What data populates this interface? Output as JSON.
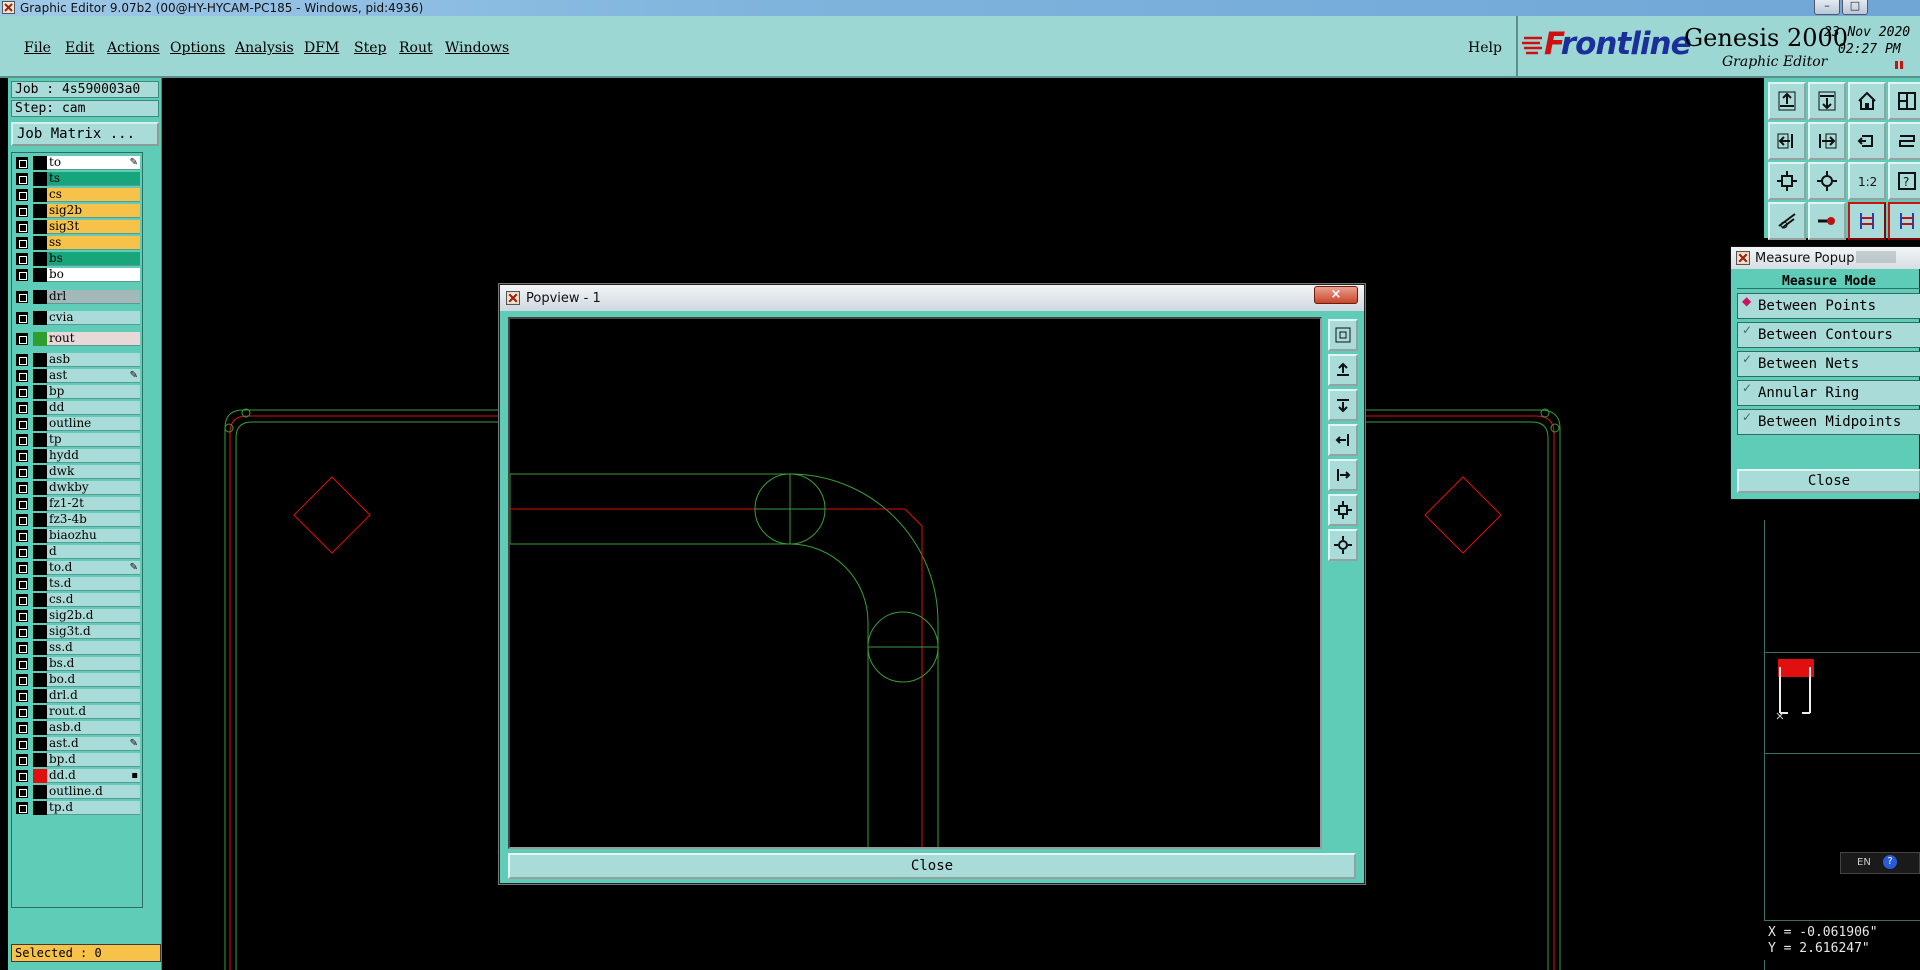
{
  "window": {
    "title": "Graphic Editor 9.07b2 (00@HY-HYCAM-PC185 - Windows, pid:4936)",
    "icon": "x-app-icon"
  },
  "menu": {
    "items": [
      "File",
      "Edit",
      "Actions",
      "Options",
      "Analysis",
      "DFM",
      "Step",
      "Rout",
      "Windows"
    ],
    "help": "Help"
  },
  "brand": {
    "logo": "Frontline",
    "product": "Genesis 2000",
    "subtitle": "Graphic Editor",
    "date": "23 Nov 2020",
    "time": "02:27 PM"
  },
  "job": {
    "job_label": "Job : 4s590003a0",
    "step_label": "Step: cam",
    "matrix_button": "Job Matrix ..."
  },
  "layers": [
    {
      "name": "to",
      "bg": "#ffffff",
      "mark": "✎",
      "sw": "#000000"
    },
    {
      "name": "ts",
      "bg": "#17a57c",
      "mark": "",
      "sw": "#000000"
    },
    {
      "name": "cs",
      "bg": "#f6c24a",
      "mark": "",
      "sw": "#000000"
    },
    {
      "name": "sig2b",
      "bg": "#f6c24a",
      "mark": "",
      "sw": "#000000"
    },
    {
      "name": "sig3t",
      "bg": "#f6c24a",
      "mark": "",
      "sw": "#000000"
    },
    {
      "name": "ss",
      "bg": "#f6c24a",
      "mark": "",
      "sw": "#000000"
    },
    {
      "name": "bs",
      "bg": "#17a57c",
      "mark": "",
      "sw": "#000000"
    },
    {
      "name": "bo",
      "bg": "#ffffff",
      "mark": "",
      "sw": "#000000"
    },
    {
      "name": "drl",
      "bg": "#a3b9b9",
      "mark": "",
      "sw": "#000000"
    },
    {
      "name": "cvia",
      "bg": "#a9dcd8",
      "mark": "",
      "sw": "#000000"
    },
    {
      "name": "rout",
      "bg": "#e8d8d8",
      "mark": "",
      "sw": "#2f9e2f"
    },
    {
      "name": "asb",
      "bg": "#a9dcd8",
      "mark": "",
      "sw": "#000000"
    },
    {
      "name": "ast",
      "bg": "#a9dcd8",
      "mark": "✎",
      "sw": "#000000"
    },
    {
      "name": "bp",
      "bg": "#a9dcd8",
      "mark": "",
      "sw": "#000000"
    },
    {
      "name": "dd",
      "bg": "#a9dcd8",
      "mark": "",
      "sw": "#000000"
    },
    {
      "name": "outline",
      "bg": "#a9dcd8",
      "mark": "",
      "sw": "#000000"
    },
    {
      "name": "tp",
      "bg": "#a9dcd8",
      "mark": "",
      "sw": "#000000"
    },
    {
      "name": "hydd",
      "bg": "#a9dcd8",
      "mark": "",
      "sw": "#000000"
    },
    {
      "name": "dwk",
      "bg": "#a9dcd8",
      "mark": "",
      "sw": "#000000"
    },
    {
      "name": "dwkby",
      "bg": "#a9dcd8",
      "mark": "",
      "sw": "#000000"
    },
    {
      "name": "fz1-2t",
      "bg": "#a9dcd8",
      "mark": "",
      "sw": "#000000"
    },
    {
      "name": "fz3-4b",
      "bg": "#a9dcd8",
      "mark": "",
      "sw": "#000000"
    },
    {
      "name": "biaozhu",
      "bg": "#a9dcd8",
      "mark": "",
      "sw": "#000000"
    },
    {
      "name": "d",
      "bg": "#a9dcd8",
      "mark": "",
      "sw": "#000000"
    },
    {
      "name": "to.d",
      "bg": "#a9dcd8",
      "mark": "✎",
      "sw": "#000000"
    },
    {
      "name": "ts.d",
      "bg": "#a9dcd8",
      "mark": "",
      "sw": "#000000"
    },
    {
      "name": "cs.d",
      "bg": "#a9dcd8",
      "mark": "",
      "sw": "#000000"
    },
    {
      "name": "sig2b.d",
      "bg": "#a9dcd8",
      "mark": "",
      "sw": "#000000"
    },
    {
      "name": "sig3t.d",
      "bg": "#a9dcd8",
      "mark": "",
      "sw": "#000000"
    },
    {
      "name": "ss.d",
      "bg": "#a9dcd8",
      "mark": "",
      "sw": "#000000"
    },
    {
      "name": "bs.d",
      "bg": "#a9dcd8",
      "mark": "",
      "sw": "#000000"
    },
    {
      "name": "bo.d",
      "bg": "#a9dcd8",
      "mark": "",
      "sw": "#000000"
    },
    {
      "name": "drl.d",
      "bg": "#a9dcd8",
      "mark": "",
      "sw": "#000000"
    },
    {
      "name": "rout.d",
      "bg": "#a9dcd8",
      "mark": "",
      "sw": "#000000"
    },
    {
      "name": "asb.d",
      "bg": "#a9dcd8",
      "mark": "",
      "sw": "#000000"
    },
    {
      "name": "ast.d",
      "bg": "#a9dcd8",
      "mark": "✎",
      "sw": "#000000"
    },
    {
      "name": "bp.d",
      "bg": "#a9dcd8",
      "mark": "",
      "sw": "#000000"
    },
    {
      "name": "dd.d",
      "bg": "#a9dcd8",
      "mark": "▪",
      "sw": "#e01010"
    },
    {
      "name": "outline.d",
      "bg": "#a9dcd8",
      "mark": "",
      "sw": "#000000"
    },
    {
      "name": "tp.d",
      "bg": "#a9dcd8",
      "mark": "",
      "sw": "#000000"
    }
  ],
  "status": {
    "selected": "Selected : 0"
  },
  "toolbar_icons": [
    "layer-up-icon",
    "layer-down-icon",
    "home-icon",
    "split-view-icon",
    "prev-layer-icon",
    "next-layer-icon",
    "undo-zoom-icon",
    "snap-icon",
    "zoom-fit-icon",
    "zoom-center-icon",
    "scale-1-2-icon",
    "help-icon",
    "measure-caliper-icon",
    "probe-icon",
    "net-analyzer-icon",
    "net-analyzer-alt-icon"
  ],
  "measure_popup": {
    "title": "Measure Popup",
    "mode_label": "Measure Mode",
    "options": [
      {
        "label": "Between Points",
        "indicator": "◆"
      },
      {
        "label": "Between Contours",
        "indicator": "✓"
      },
      {
        "label": "Between Nets",
        "indicator": "✓"
      },
      {
        "label": "Annular Ring",
        "indicator": "✓"
      },
      {
        "label": "Between Midpoints",
        "indicator": "✓"
      }
    ],
    "close_label": "Close"
  },
  "popview": {
    "title": "Popview - 1",
    "close_label": "Close",
    "close_x": "×",
    "tool_icons": [
      "zoom-box-icon",
      "layer-up-icon",
      "layer-down-icon",
      "pan-left-icon",
      "pan-right-icon",
      "zoom-fit-icon",
      "zoom-center-icon"
    ]
  },
  "coords": {
    "x": "X = -0.061906\"",
    "y": "Y = 2.616247\""
  },
  "lang": "EN",
  "colors": {
    "panel": "#5fccb8",
    "button": "#a9dcd8",
    "menubar": "#9dd7d3",
    "outline_green": "#3a9e3a",
    "rout_red": "#e01010",
    "selected_yellow": "#f6c24a"
  }
}
